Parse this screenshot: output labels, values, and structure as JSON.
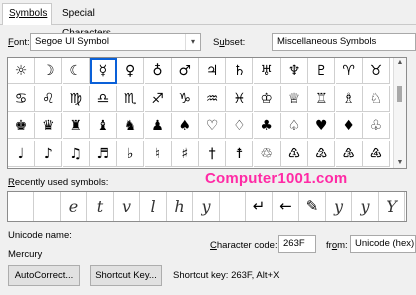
{
  "tabs": {
    "symbols": "Symbols",
    "special": "Special Characters"
  },
  "font": {
    "label_u": "F",
    "label_rest": "ont:",
    "value": "Segoe UI Symbol"
  },
  "subset": {
    "label_pre": "S",
    "label_u": "u",
    "label_rest": "bset:",
    "value": "Miscellaneous Symbols"
  },
  "grid": [
    [
      "☼",
      "☽",
      "☾",
      "☿",
      "♀",
      "♁",
      "♂",
      "♃",
      "♄",
      "♅",
      "♆",
      "♇",
      "♈",
      "♉"
    ],
    [
      "♋",
      "♌",
      "♍",
      "♎",
      "♏",
      "♐",
      "♑",
      "♒",
      "♓",
      "♔",
      "♕",
      "♖",
      "♗",
      "♘"
    ],
    [
      "♚",
      "♛",
      "♜",
      "♝",
      "♞",
      "♟",
      "♠",
      "♡",
      "♢",
      "♣",
      "♤",
      "♥",
      "♦",
      "♧"
    ],
    [
      "♩",
      "♪",
      "♫",
      "♬",
      "♭",
      "♮",
      "♯",
      "†",
      "☨",
      "♲",
      "♳",
      "♴",
      "♵",
      "♶"
    ]
  ],
  "recent": {
    "label_u": "R",
    "label_rest": "ecently used symbols:",
    "items": [
      "",
      "",
      "e",
      "t",
      "v",
      "l",
      "h",
      "y",
      "",
      "↵",
      "←",
      "✎",
      "y",
      "y",
      "Y"
    ]
  },
  "watermark": "Computer1001.com",
  "unicode_name": {
    "label": "Unicode name:",
    "value": "Mercury"
  },
  "char_code": {
    "label_u": "C",
    "label_rest": "haracter code:",
    "value": "263F"
  },
  "from": {
    "label_pre": "fr",
    "label_u": "o",
    "label_rest": "m:",
    "value": "Unicode (hex)"
  },
  "autocorrect": "AutoCorrect...",
  "shortcut_key_btn": "Shortcut Key...",
  "shortcut_text": "Shortcut key: 263F, Alt+X",
  "colors": {
    "selection": "#0a60d8",
    "watermark": "#ff2aa5"
  }
}
